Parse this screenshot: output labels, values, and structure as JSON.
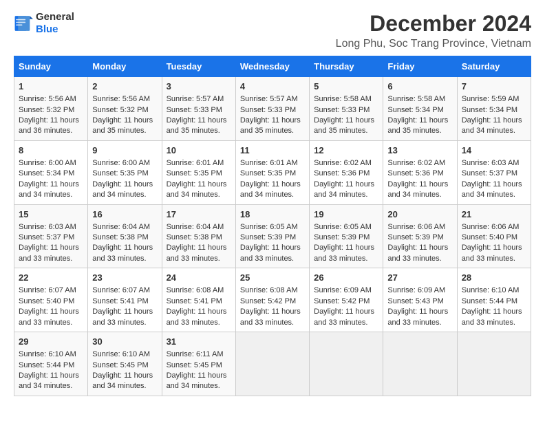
{
  "logo": {
    "line1": "General",
    "line2": "Blue"
  },
  "title": "December 2024",
  "subtitle": "Long Phu, Soc Trang Province, Vietnam",
  "days_of_week": [
    "Sunday",
    "Monday",
    "Tuesday",
    "Wednesday",
    "Thursday",
    "Friday",
    "Saturday"
  ],
  "weeks": [
    [
      {
        "day": 1,
        "sunrise": "5:56 AM",
        "sunset": "5:32 PM",
        "daylight": "11 hours and 36 minutes."
      },
      {
        "day": 2,
        "sunrise": "5:56 AM",
        "sunset": "5:32 PM",
        "daylight": "11 hours and 35 minutes."
      },
      {
        "day": 3,
        "sunrise": "5:57 AM",
        "sunset": "5:33 PM",
        "daylight": "11 hours and 35 minutes."
      },
      {
        "day": 4,
        "sunrise": "5:57 AM",
        "sunset": "5:33 PM",
        "daylight": "11 hours and 35 minutes."
      },
      {
        "day": 5,
        "sunrise": "5:58 AM",
        "sunset": "5:33 PM",
        "daylight": "11 hours and 35 minutes."
      },
      {
        "day": 6,
        "sunrise": "5:58 AM",
        "sunset": "5:34 PM",
        "daylight": "11 hours and 35 minutes."
      },
      {
        "day": 7,
        "sunrise": "5:59 AM",
        "sunset": "5:34 PM",
        "daylight": "11 hours and 34 minutes."
      }
    ],
    [
      {
        "day": 8,
        "sunrise": "6:00 AM",
        "sunset": "5:34 PM",
        "daylight": "11 hours and 34 minutes."
      },
      {
        "day": 9,
        "sunrise": "6:00 AM",
        "sunset": "5:35 PM",
        "daylight": "11 hours and 34 minutes."
      },
      {
        "day": 10,
        "sunrise": "6:01 AM",
        "sunset": "5:35 PM",
        "daylight": "11 hours and 34 minutes."
      },
      {
        "day": 11,
        "sunrise": "6:01 AM",
        "sunset": "5:35 PM",
        "daylight": "11 hours and 34 minutes."
      },
      {
        "day": 12,
        "sunrise": "6:02 AM",
        "sunset": "5:36 PM",
        "daylight": "11 hours and 34 minutes."
      },
      {
        "day": 13,
        "sunrise": "6:02 AM",
        "sunset": "5:36 PM",
        "daylight": "11 hours and 34 minutes."
      },
      {
        "day": 14,
        "sunrise": "6:03 AM",
        "sunset": "5:37 PM",
        "daylight": "11 hours and 34 minutes."
      }
    ],
    [
      {
        "day": 15,
        "sunrise": "6:03 AM",
        "sunset": "5:37 PM",
        "daylight": "11 hours and 33 minutes."
      },
      {
        "day": 16,
        "sunrise": "6:04 AM",
        "sunset": "5:38 PM",
        "daylight": "11 hours and 33 minutes."
      },
      {
        "day": 17,
        "sunrise": "6:04 AM",
        "sunset": "5:38 PM",
        "daylight": "11 hours and 33 minutes."
      },
      {
        "day": 18,
        "sunrise": "6:05 AM",
        "sunset": "5:39 PM",
        "daylight": "11 hours and 33 minutes."
      },
      {
        "day": 19,
        "sunrise": "6:05 AM",
        "sunset": "5:39 PM",
        "daylight": "11 hours and 33 minutes."
      },
      {
        "day": 20,
        "sunrise": "6:06 AM",
        "sunset": "5:39 PM",
        "daylight": "11 hours and 33 minutes."
      },
      {
        "day": 21,
        "sunrise": "6:06 AM",
        "sunset": "5:40 PM",
        "daylight": "11 hours and 33 minutes."
      }
    ],
    [
      {
        "day": 22,
        "sunrise": "6:07 AM",
        "sunset": "5:40 PM",
        "daylight": "11 hours and 33 minutes."
      },
      {
        "day": 23,
        "sunrise": "6:07 AM",
        "sunset": "5:41 PM",
        "daylight": "11 hours and 33 minutes."
      },
      {
        "day": 24,
        "sunrise": "6:08 AM",
        "sunset": "5:41 PM",
        "daylight": "11 hours and 33 minutes."
      },
      {
        "day": 25,
        "sunrise": "6:08 AM",
        "sunset": "5:42 PM",
        "daylight": "11 hours and 33 minutes."
      },
      {
        "day": 26,
        "sunrise": "6:09 AM",
        "sunset": "5:42 PM",
        "daylight": "11 hours and 33 minutes."
      },
      {
        "day": 27,
        "sunrise": "6:09 AM",
        "sunset": "5:43 PM",
        "daylight": "11 hours and 33 minutes."
      },
      {
        "day": 28,
        "sunrise": "6:10 AM",
        "sunset": "5:44 PM",
        "daylight": "11 hours and 33 minutes."
      }
    ],
    [
      {
        "day": 29,
        "sunrise": "6:10 AM",
        "sunset": "5:44 PM",
        "daylight": "11 hours and 34 minutes."
      },
      {
        "day": 30,
        "sunrise": "6:10 AM",
        "sunset": "5:45 PM",
        "daylight": "11 hours and 34 minutes."
      },
      {
        "day": 31,
        "sunrise": "6:11 AM",
        "sunset": "5:45 PM",
        "daylight": "11 hours and 34 minutes."
      },
      null,
      null,
      null,
      null
    ]
  ]
}
